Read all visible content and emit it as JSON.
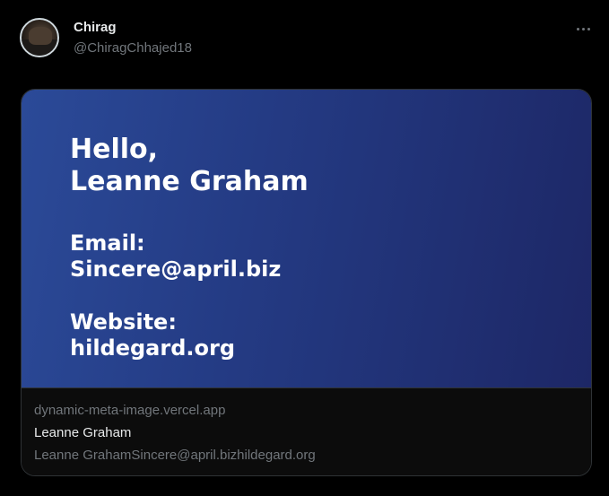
{
  "user": {
    "display_name": "Chirag",
    "handle": "@ChiragChhajed18"
  },
  "header": {
    "more_icon": "more-horizontal-icon"
  },
  "card": {
    "image_text": {
      "greeting_line1": "Hello,",
      "greeting_line2": "Leanne Graham",
      "email_label": "Email:",
      "email_value": "Sincere@april.biz",
      "website_label": "Website:",
      "website_value": "hildegard.org"
    },
    "domain": "dynamic-meta-image.vercel.app",
    "title": "Leanne Graham",
    "description": "Leanne GrahamSincere@april.bizhildegard.org",
    "colors": {
      "gradient_start": "#2b4a98",
      "gradient_end": "#1d2766"
    }
  }
}
